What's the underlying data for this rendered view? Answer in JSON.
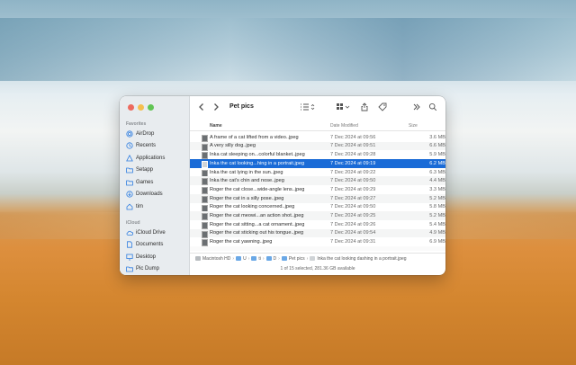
{
  "sidebar": {
    "favorites_header": "Favorites",
    "icloud_header": "iCloud",
    "favorites": [
      {
        "label": "AirDrop",
        "icon": "airdrop-icon"
      },
      {
        "label": "Recents",
        "icon": "clock-icon"
      },
      {
        "label": "Applications",
        "icon": "applications-icon"
      },
      {
        "label": "Setapp",
        "icon": "folder-icon"
      },
      {
        "label": "Games",
        "icon": "folder-icon"
      },
      {
        "label": "Downloads",
        "icon": "download-icon"
      },
      {
        "label": "tim",
        "icon": "home-icon"
      }
    ],
    "icloud": [
      {
        "label": "iCloud Drive",
        "icon": "cloud-icon"
      },
      {
        "label": "Documents",
        "icon": "document-icon"
      },
      {
        "label": "Desktop",
        "icon": "desktop-icon"
      },
      {
        "label": "Pic Dump",
        "icon": "folder-icon"
      }
    ]
  },
  "toolbar": {
    "title": "Pet pics"
  },
  "columns": {
    "name": "Name",
    "date": "Date Modified",
    "size": "Size"
  },
  "files": [
    {
      "name": "A frame of a cat lifted from a video..jpeg",
      "date": "7 Dec 2024 at 09:56",
      "size": "3.6 MB"
    },
    {
      "name": "A very silly dog..jpeg",
      "date": "7 Dec 2024 at 09:51",
      "size": "6.6 MB"
    },
    {
      "name": "Inka cat sleeping on...colorful blanket..jpeg",
      "date": "7 Dec 2024 at 09:28",
      "size": "5.9 MB"
    },
    {
      "name": "Inka the cat looking...hing in a portrait.jpeg",
      "date": "7 Dec 2024 at 09:19",
      "size": "6.2 MB"
    },
    {
      "name": "Inka the cat lying in the sun..jpeg",
      "date": "7 Dec 2024 at 09:22",
      "size": "6.3 MB"
    },
    {
      "name": "Inka the cat's chin and nose..jpeg",
      "date": "7 Dec 2024 at 09:50",
      "size": "4.4 MB"
    },
    {
      "name": "Roger the cat close...wide-angle lens..jpeg",
      "date": "7 Dec 2024 at 09:29",
      "size": "3.3 MB"
    },
    {
      "name": "Roger the cat in a silly pose..jpeg",
      "date": "7 Dec 2024 at 09:27",
      "size": "5.2 MB"
    },
    {
      "name": "Roger the cat looking concerned..jpeg",
      "date": "7 Dec 2024 at 09:50",
      "size": "5.8 MB"
    },
    {
      "name": "Roger the cat meowi...an action shot..jpeg",
      "date": "7 Dec 2024 at 09:25",
      "size": "5.2 MB"
    },
    {
      "name": "Roger the cat sitting...a cat ornament..jpeg",
      "date": "7 Dec 2024 at 09:26",
      "size": "5.4 MB"
    },
    {
      "name": "Roger the cat sticking out his tongue..jpeg",
      "date": "7 Dec 2024 at 09:54",
      "size": "4.9 MB"
    },
    {
      "name": "Roger the cat yawning..jpeg",
      "date": "7 Dec 2024 at 09:31",
      "size": "6.9 MB"
    }
  ],
  "selected_index": 3,
  "pathbar": {
    "root": "Macintosh HD",
    "seg1": "U",
    "seg2": "ti",
    "seg3": "D",
    "folder": "Pet pics",
    "file": "Inka the cat looking dashing in a portrait.jpeg"
  },
  "status": "1 of 15 selected, 281.36 GB available",
  "colors": {
    "selection": "#1a6bd7",
    "accent": "#1a6bd7"
  }
}
